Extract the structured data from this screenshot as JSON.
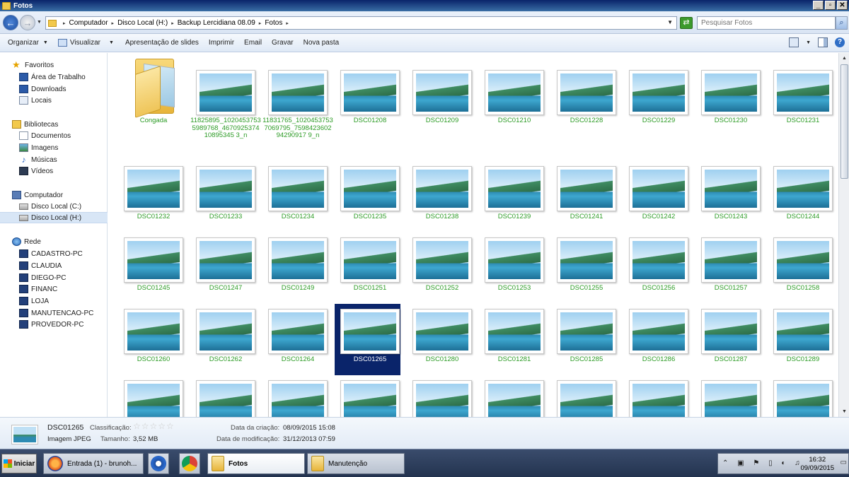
{
  "window": {
    "title": "Fotos"
  },
  "address": {
    "breadcrumb": [
      "Computador",
      "Disco Local (H:)",
      "Backup Lercidiana 08.09",
      "Fotos"
    ],
    "search_placeholder": "Pesquisar Fotos"
  },
  "toolbar": {
    "organize": "Organizar",
    "view": "Visualizar",
    "slides": "Apresentação de slides",
    "print": "Imprimir",
    "email": "Email",
    "burn": "Gravar",
    "new_folder": "Nova pasta"
  },
  "nav": {
    "favorites": {
      "label": "Favoritos",
      "items": [
        "Área de Trabalho",
        "Downloads",
        "Locais"
      ]
    },
    "libraries": {
      "label": "Bibliotecas",
      "items": [
        "Documentos",
        "Imagens",
        "Músicas",
        "Vídeos"
      ]
    },
    "computer": {
      "label": "Computador",
      "items": [
        "Disco Local (C:)",
        "Disco Local (H:)"
      ],
      "selected": "Disco Local (H:)"
    },
    "network": {
      "label": "Rede",
      "items": [
        "CADASTRO-PC",
        "CLAUDIA",
        "DIEGO-PC",
        "FINANC",
        "LOJA",
        "MANUTENCAO-PC",
        "PROVEDOR-PC"
      ]
    }
  },
  "files": [
    {
      "name": "Congada",
      "type": "folder"
    },
    {
      "name": "11825895_10204537535989768_467092537410895345 3_n",
      "type": "image"
    },
    {
      "name": "11831765_10204537537069795_759842360294290917 9_n",
      "type": "image"
    },
    {
      "name": "DSC01208",
      "type": "image"
    },
    {
      "name": "DSC01209",
      "type": "image"
    },
    {
      "name": "DSC01210",
      "type": "image"
    },
    {
      "name": "DSC01228",
      "type": "image"
    },
    {
      "name": "DSC01229",
      "type": "image"
    },
    {
      "name": "DSC01230",
      "type": "image"
    },
    {
      "name": "DSC01231",
      "type": "image"
    },
    {
      "name": "DSC01232",
      "type": "image"
    },
    {
      "name": "DSC01233",
      "type": "image"
    },
    {
      "name": "DSC01234",
      "type": "image"
    },
    {
      "name": "DSC01235",
      "type": "image"
    },
    {
      "name": "DSC01238",
      "type": "image"
    },
    {
      "name": "DSC01239",
      "type": "image"
    },
    {
      "name": "DSC01241",
      "type": "image"
    },
    {
      "name": "DSC01242",
      "type": "image"
    },
    {
      "name": "DSC01243",
      "type": "image"
    },
    {
      "name": "DSC01244",
      "type": "image"
    },
    {
      "name": "DSC01245",
      "type": "image"
    },
    {
      "name": "DSC01247",
      "type": "image"
    },
    {
      "name": "DSC01249",
      "type": "image"
    },
    {
      "name": "DSC01251",
      "type": "image"
    },
    {
      "name": "DSC01252",
      "type": "image"
    },
    {
      "name": "DSC01253",
      "type": "image"
    },
    {
      "name": "DSC01255",
      "type": "image"
    },
    {
      "name": "DSC01256",
      "type": "image"
    },
    {
      "name": "DSC01257",
      "type": "image"
    },
    {
      "name": "DSC01258",
      "type": "image"
    },
    {
      "name": "DSC01260",
      "type": "image"
    },
    {
      "name": "DSC01262",
      "type": "image"
    },
    {
      "name": "DSC01264",
      "type": "image"
    },
    {
      "name": "DSC01265",
      "type": "image",
      "selected": true
    },
    {
      "name": "DSC01280",
      "type": "image"
    },
    {
      "name": "DSC01281",
      "type": "image"
    },
    {
      "name": "DSC01285",
      "type": "image"
    },
    {
      "name": "DSC01286",
      "type": "image"
    },
    {
      "name": "DSC01287",
      "type": "image"
    },
    {
      "name": "DSC01289",
      "type": "image"
    },
    {
      "name": "",
      "type": "image"
    },
    {
      "name": "",
      "type": "image"
    },
    {
      "name": "",
      "type": "image"
    },
    {
      "name": "",
      "type": "image"
    },
    {
      "name": "",
      "type": "image"
    },
    {
      "name": "",
      "type": "image"
    },
    {
      "name": "",
      "type": "image"
    },
    {
      "name": "",
      "type": "image"
    },
    {
      "name": "",
      "type": "image"
    },
    {
      "name": "",
      "type": "image"
    }
  ],
  "details": {
    "name": "DSC01265",
    "type_label": "Imagem JPEG",
    "rating_label": "Classificação:",
    "rating_stars": "☆☆☆☆☆",
    "size_label": "Tamanho:",
    "size": "3,52 MB",
    "created_label": "Data da criação:",
    "created": "08/09/2015 15:08",
    "modified_label": "Data de modificação:",
    "modified": "31/12/2013 07:59"
  },
  "taskbar": {
    "start": "Iniciar",
    "buttons": [
      "Entrada (1) - brunoh...",
      "Fotos",
      "Manutenção"
    ],
    "clock_time": "16:32",
    "clock_date": "09/09/2015"
  },
  "colors": {
    "filename": "#2c9b25",
    "selection": "#0a246a"
  }
}
